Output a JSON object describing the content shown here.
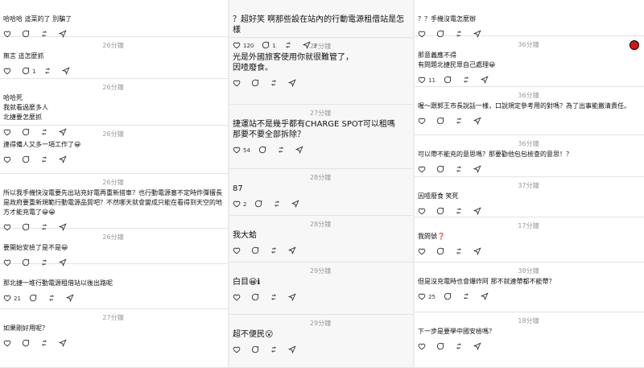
{
  "col0": [
    {
      "ts": "",
      "text": "哈哈哈 這菜的了 別騙了",
      "likes": "",
      "comments": "",
      "reposts": "",
      "shares": ""
    },
    {
      "ts": "26分鐘",
      "text": "無言 這怎麼抓",
      "likes": "",
      "comments": "1",
      "reposts": "",
      "shares": ""
    },
    {
      "ts": "26分鐘",
      "text": "哈哈死\n我就看過麼多人\n北捷要怎麼抓",
      "likes": "",
      "comments": "",
      "reposts": "",
      "shares": ""
    },
    {
      "ts": "26分鐘",
      "text": "連得備人又多一項工作了😀",
      "likes": "",
      "comments": "",
      "reposts": "",
      "shares": ""
    },
    {
      "ts": "26分鐘",
      "text": "所以我手機快沒電要先出站充好電再重新搭車？也行動電源塞不定時炸彈擅長是政府要重新規範行動電源品質吧？不然哪天就會變成只能在看得到天空的地方才能充電了😀😀",
      "likes": "",
      "comments": "",
      "reposts": "",
      "shares": ""
    },
    {
      "ts": "26分鐘",
      "text": "要開始安檢了是不是😀",
      "likes": "",
      "comments": "",
      "reposts": "",
      "shares": ""
    },
    {
      "ts": "",
      "text": "那北捷一堆行動電源租借站以後出路呢",
      "likes": "21",
      "comments": "",
      "reposts": "",
      "shares": ""
    },
    {
      "ts": "27分鐘",
      "text": "如果剛好用呢？",
      "likes": "",
      "comments": "",
      "reposts": "",
      "shares": ""
    }
  ],
  "col1": [
    {
      "ts": "",
      "text": "？超好笑 啊那些設在站內的行動電源租借站是怎樣",
      "likes": "120",
      "comments": "1",
      "reposts": "",
      "shares": "3"
    },
    {
      "ts": "27分鐘",
      "text": "光是外國旅客使用你就很難管了，\n因噎廢食。",
      "likes": "",
      "comments": "",
      "reposts": "",
      "shares": ""
    },
    {
      "ts": "27分鐘",
      "text": "捷運站不是幾乎都有CHARGE SPOT可以租嗎\n那要不要全部拆除？",
      "likes": "54",
      "comments": "",
      "reposts": "",
      "shares": ""
    },
    {
      "ts": "28分鐘",
      "text": "87",
      "likes": "2",
      "comments": "",
      "reposts": "",
      "shares": ""
    },
    {
      "ts": "28分鐘",
      "text": "我大蛤",
      "likes": "",
      "comments": "",
      "reposts": "",
      "shares": ""
    },
    {
      "ts": "29分鐘",
      "text": "白目😀ℹ",
      "likes": "",
      "comments": "",
      "reposts": "",
      "shares": ""
    },
    {
      "ts": "29分鐘",
      "text": "超不便民😮",
      "likes": "",
      "comments": "",
      "reposts": "",
      "shares": ""
    }
  ],
  "col2": [
    {
      "ts": "",
      "text": "？？手機沒電怎麼辦",
      "likes": "",
      "comments": "",
      "reposts": "",
      "shares": ""
    },
    {
      "ts": "36分鐘",
      "text": "那意義應不得\n有問題北捷民眾自己處理😀",
      "likes": "11",
      "comments": "",
      "reposts": "",
      "shares": ""
    },
    {
      "ts": "36分鐘",
      "text": "喔～跟郭王市長說話一樣，口說規定參考用的對嗎？為了出事能撇清責任。",
      "likes": "",
      "comments": "",
      "reposts": "",
      "shares": ""
    },
    {
      "ts": "36分鐘",
      "text": "可以帶不能充的意思嗎？那要勸他包包檢查的意思！？",
      "likes": "",
      "comments": "",
      "reposts": "",
      "shares": ""
    },
    {
      "ts": "37分鐘",
      "text": "因噎廢食 笑死",
      "likes": "",
      "comments": "",
      "reposts": "",
      "shares": ""
    },
    {
      "ts": "17分鐘",
      "text": "我問號❓",
      "likes": "",
      "comments": "",
      "reposts": "",
      "shares": ""
    },
    {
      "ts": "38分鐘",
      "text": "但是沒充電時也會爆炸阿 那不就連帶都不能帶？",
      "likes": "25",
      "comments": "",
      "reposts": "",
      "shares": ""
    },
    {
      "ts": "18分鐘",
      "text": "下一步是要學中國安檢嗎？",
      "likes": "",
      "comments": "",
      "reposts": "",
      "shares": ""
    }
  ]
}
